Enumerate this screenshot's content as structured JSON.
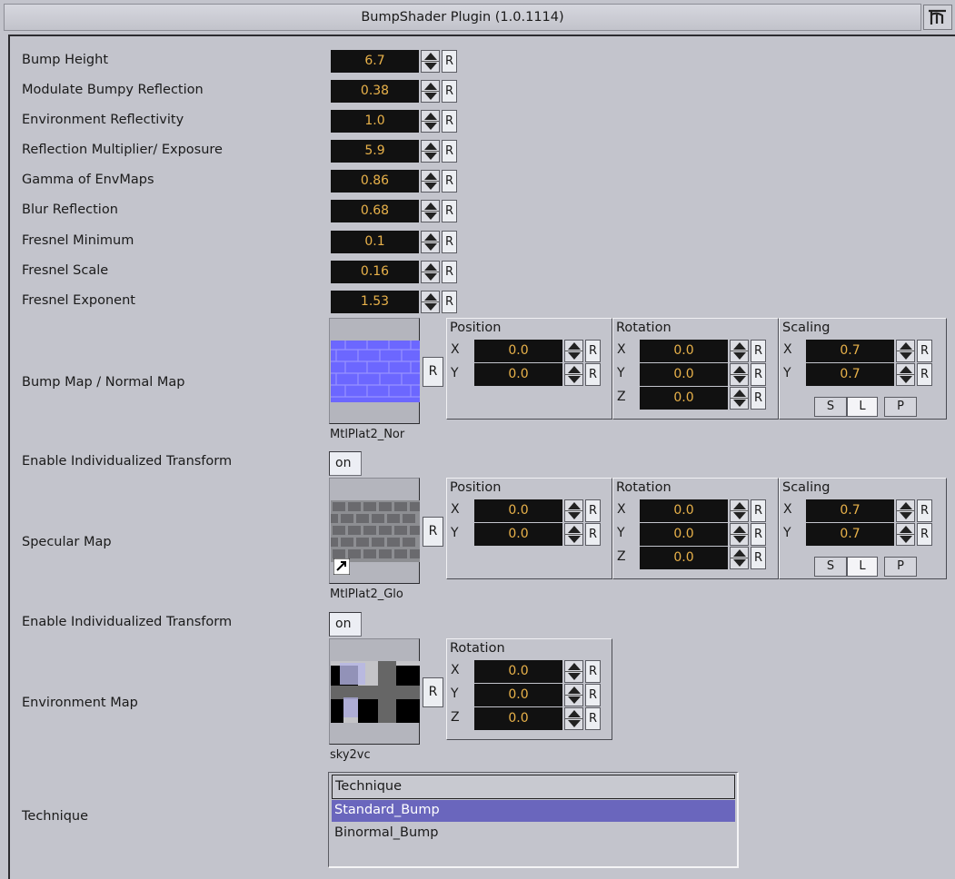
{
  "window": {
    "title": "BumpShader Plugin (1.0.1114)",
    "icon": "plugin-logo-icon"
  },
  "reset_label": "R",
  "params": [
    {
      "label": "Bump Height",
      "value": "6.7"
    },
    {
      "label": "Modulate Bumpy Reflection",
      "value": "0.38"
    },
    {
      "label": "Environment Reflectivity",
      "value": "1.0"
    },
    {
      "label": "Reflection Multiplier/ Exposure",
      "value": "5.9"
    },
    {
      "label": "Gamma of EnvMaps",
      "value": "0.86"
    },
    {
      "label": "Blur Reflection",
      "value": "0.68"
    },
    {
      "label": "Fresnel Minimum",
      "value": "0.1"
    },
    {
      "label": "Fresnel Scale",
      "value": "0.16"
    },
    {
      "label": "Fresnel Exponent",
      "value": "1.53"
    }
  ],
  "group_titles": {
    "position": "Position",
    "rotation": "Rotation",
    "scaling": "Scaling"
  },
  "axes": {
    "x": "X",
    "y": "Y",
    "z": "Z"
  },
  "scale_modes": [
    "S",
    "L",
    "P"
  ],
  "bump_map": {
    "label": "Bump Map / Normal Map",
    "file": "MtlPlat2_Nor",
    "position": {
      "x": "0.0",
      "y": "0.0"
    },
    "rotation": {
      "x": "0.0",
      "y": "0.0",
      "z": "0.0"
    },
    "scaling": {
      "x": "0.7",
      "y": "0.7"
    },
    "enable_label": "Enable Individualized Transform",
    "enable_value": "on"
  },
  "specular_map": {
    "label": "Specular Map",
    "file": "MtlPlat2_Glo",
    "position": {
      "x": "0.0",
      "y": "0.0"
    },
    "rotation": {
      "x": "0.0",
      "y": "0.0",
      "z": "0.0"
    },
    "scaling": {
      "x": "0.7",
      "y": "0.7"
    },
    "enable_label": "Enable Individualized Transform",
    "enable_value": "on"
  },
  "environment_map": {
    "label": "Environment Map",
    "file": "sky2vc",
    "rotation": {
      "x": "0.0",
      "y": "0.0",
      "z": "0.0"
    }
  },
  "technique": {
    "label": "Technique",
    "header": "Technique",
    "options": [
      "Standard_Bump",
      "Binormal_Bump"
    ],
    "selected": "Standard_Bump"
  },
  "colors": {
    "field_bg": "#111111",
    "field_text": "#e9b24a",
    "selection": "#6a66bd",
    "panel_bg": "#c3c4cc"
  }
}
